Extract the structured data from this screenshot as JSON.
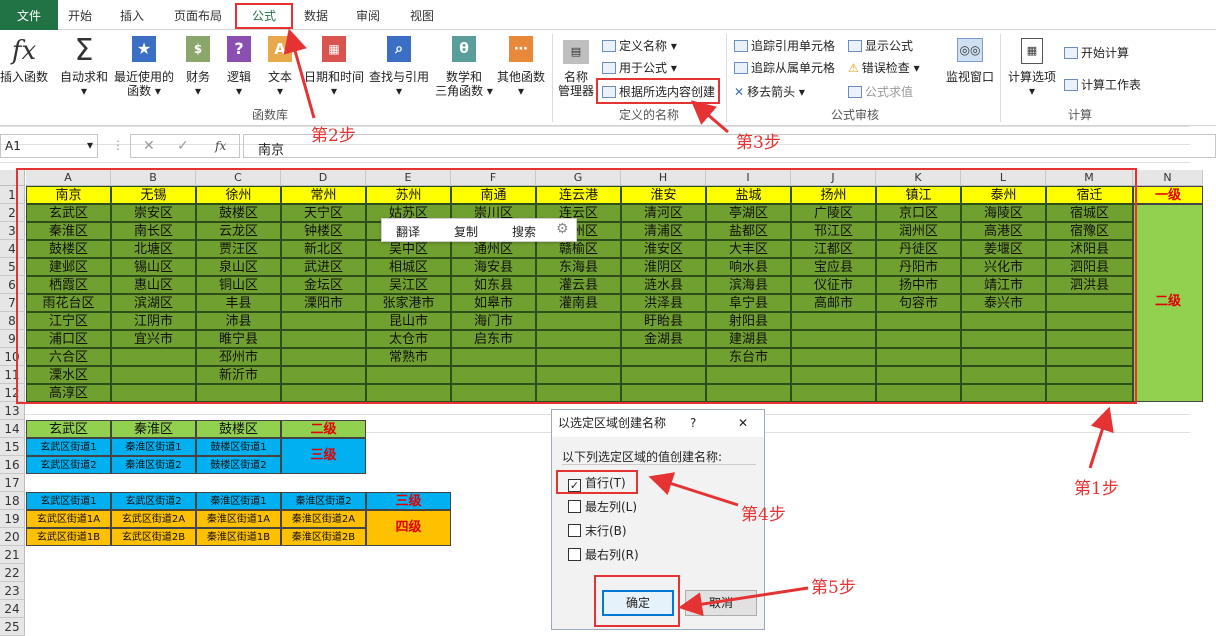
{
  "tabs": [
    "文件",
    "开始",
    "插入",
    "页面布局",
    "公式",
    "数据",
    "审阅",
    "视图"
  ],
  "ribbon": {
    "fx_insert": "插入函数",
    "autosum": "自动求和",
    "recent": [
      "最近使用的",
      "函数"
    ],
    "finance": "财务",
    "logic": "逻辑",
    "text": "文本",
    "datetime": "日期和时间",
    "lookup": "查找与引用",
    "math": [
      "数学和",
      "三角函数"
    ],
    "other": "其他函数",
    "group_lib": "函数库",
    "name_mgr": [
      "名称",
      "管理器"
    ],
    "define_name": "定义名称",
    "use_formula": "用于公式",
    "create_sel": "根据所选内容创建",
    "group_names": "定义的名称",
    "trace_prec": "追踪引用单元格",
    "trace_dep": "追踪从属单元格",
    "remove_arrows": "移去箭头",
    "show_formulas": "显示公式",
    "error_check": "错误检查",
    "eval_formula": "公式求值",
    "group_audit": "公式审核",
    "watch": "监视窗口",
    "calc_opts": "计算选项",
    "calc_now": "开始计算",
    "calc_sheet": "计算工作表",
    "group_calc": "计算"
  },
  "formula_bar": {
    "namebox": "A1",
    "fx": "fx",
    "content": "南京"
  },
  "columns": [
    "A",
    "B",
    "C",
    "D",
    "E",
    "F",
    "G",
    "H",
    "I",
    "J",
    "K",
    "L",
    "M",
    "N"
  ],
  "rows": [
    "1",
    "2",
    "3",
    "4",
    "5",
    "6",
    "7",
    "8",
    "9",
    "10",
    "11",
    "12",
    "13",
    "14",
    "15",
    "16",
    "17",
    "18",
    "19",
    "20",
    "21",
    "22",
    "23",
    "24",
    "25"
  ],
  "header_cities": [
    "南京",
    "无锡",
    "徐州",
    "常州",
    "苏州",
    "南通",
    "连云港",
    "淮安",
    "盐城",
    "扬州",
    "镇江",
    "泰州",
    "宿迁"
  ],
  "districts": [
    [
      "玄武区",
      "秦淮区",
      "鼓楼区",
      "建邺区",
      "栖霞区",
      "雨花台区",
      "江宁区",
      "浦口区",
      "六合区",
      "溧水区",
      "高淳区"
    ],
    [
      "崇安区",
      "南长区",
      "北塘区",
      "锡山区",
      "惠山区",
      "滨湖区",
      "江阴市",
      "宜兴市"
    ],
    [
      "鼓楼区",
      "云龙区",
      "贾汪区",
      "泉山区",
      "铜山区",
      "丰县",
      "沛县",
      "睢宁县",
      "邳州市",
      "新沂市"
    ],
    [
      "天宁区",
      "钟楼区",
      "新北区",
      "武进区",
      "金坛区",
      "溧阳市"
    ],
    [
      "姑苏区",
      "虎丘区",
      "吴中区",
      "相城区",
      "吴江区",
      "张家港市",
      "昆山市",
      "太仓市",
      "常熟市"
    ],
    [
      "崇川区",
      "港闸区",
      "通州区",
      "海安县",
      "如东县",
      "如皋市",
      "海门市",
      "启东市"
    ],
    [
      "连云区",
      "海州区",
      "赣榆区",
      "东海县",
      "灌云县",
      "灌南县"
    ],
    [
      "清河区",
      "清浦区",
      "淮安区",
      "淮阴区",
      "涟水县",
      "洪泽县",
      "盱眙县",
      "金湖县"
    ],
    [
      "亭湖区",
      "盐都区",
      "大丰区",
      "响水县",
      "滨海县",
      "阜宁县",
      "射阳县",
      "建湖县",
      "东台市"
    ],
    [
      "广陵区",
      "邗江区",
      "江都区",
      "宝应县",
      "仪征市",
      "高邮市"
    ],
    [
      "京口区",
      "润州区",
      "丹徒区",
      "丹阳市",
      "扬中市",
      "句容市"
    ],
    [
      "海陵区",
      "高港区",
      "姜堰区",
      "兴化市",
      "靖江市",
      "泰兴市"
    ],
    [
      "宿城区",
      "宿豫区",
      "沭阳县",
      "泗阳县",
      "泗洪县"
    ]
  ],
  "level_labels": {
    "l1": "一级",
    "l2": "二级",
    "l2b": "二级",
    "l3": "三级",
    "l3b": "三级",
    "l4": "四级"
  },
  "lower": {
    "r14": [
      "玄武区",
      "秦淮区",
      "鼓楼区"
    ],
    "r15": [
      "玄武区街道1",
      "秦淮区街道1",
      "鼓楼区街道1"
    ],
    "r16": [
      "玄武区街道2",
      "秦淮区街道2",
      "鼓楼区街道2"
    ],
    "r18": [
      "玄武区街道1",
      "玄武区街道2",
      "秦淮区街道1",
      "秦淮区街道2"
    ],
    "r19": [
      "玄武区街道1A",
      "玄武区街道2A",
      "秦淮区街道1A",
      "秦淮区街道2A"
    ],
    "r20": [
      "玄武区街道1B",
      "玄武区街道2B",
      "秦淮区街道1B",
      "秦淮区街道2B"
    ]
  },
  "context_menu": [
    "翻译",
    "复制",
    "搜索"
  ],
  "dialog": {
    "title": "以选定区域创建名称",
    "help": "?",
    "close": "✕",
    "prompt": "以下列选定区域的值创建名称:",
    "options": [
      "首行(T)",
      "最左列(L)",
      "末行(B)",
      "最右列(R)"
    ],
    "checked": [
      true,
      false,
      false,
      false
    ],
    "ok": "确定",
    "cancel": "取消"
  },
  "steps": [
    "第1步",
    "第2步",
    "第3步",
    "第4步",
    "第5步"
  ],
  "colors": {
    "green": "#70a030",
    "yellow": "#ffff00",
    "lightgreen": "#92d050",
    "blue": "#00b0f0",
    "orange": "#ffc000",
    "red": "#e53333",
    "excel": "#217346"
  }
}
